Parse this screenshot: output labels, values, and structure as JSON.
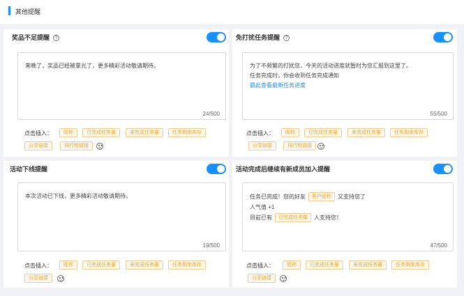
{
  "section_title": "其他提醒",
  "insert_label": "点击插入：",
  "colors": {
    "accent": "#1890ff",
    "tag_text": "#f5a623",
    "tag_border": "#f9c98f",
    "tag_bg": "#fff8ee"
  },
  "cards": [
    {
      "title": "奖品不足提醒",
      "has_help": true,
      "enabled": true,
      "content_lines": [
        "来晚了，奖品已经被拿光了，更多精彩活动敬请期待。"
      ],
      "counter": "24/500",
      "chips": [
        "昵称",
        "已完成任务量",
        "未完成任务量",
        "任务剩余库存",
        "分享链接",
        "排行榜链接"
      ]
    },
    {
      "title": "免打扰任务提醒",
      "has_help": true,
      "enabled": true,
      "content_lines": [
        "为了不频繁的打扰您，今天的活动进度就暂时为您汇报到这里了。",
        "任务完成时，你会收到任务完成通知"
      ],
      "content_link": "戳此查看最新任务进度",
      "counter": "55/500",
      "chips": [
        "昵称",
        "已完成任务量",
        "未完成任务量",
        "任务剩余库存",
        "分享链接",
        "排行榜链接"
      ]
    },
    {
      "title": "活动下线提醒",
      "has_help": false,
      "enabled": true,
      "content_lines": [
        "本次活动已下线，更多精彩活动敬请期待。"
      ],
      "counter": "19/500",
      "chips": [
        "昵称",
        "已完成任务量",
        "未完成任务量",
        "任务剩余库存",
        "分享链接"
      ]
    },
    {
      "title": "活动完成后继续有新成员加入提醒",
      "has_help": false,
      "enabled": true,
      "content_parts": {
        "line1_prefix": "任务已完成！您的好友",
        "line1_tag": "客户昵称",
        "line1_suffix": "又支持您了",
        "line2": "人气值 +1",
        "line3_prefix": "目前已有",
        "line3_tag": "已完成任务量",
        "line3_suffix": "人支持您！"
      },
      "counter": "47/500",
      "chips": [
        "昵称",
        "已完成任务量",
        "未完成任务量",
        "任务剩余库存",
        "分享链接"
      ]
    }
  ]
}
